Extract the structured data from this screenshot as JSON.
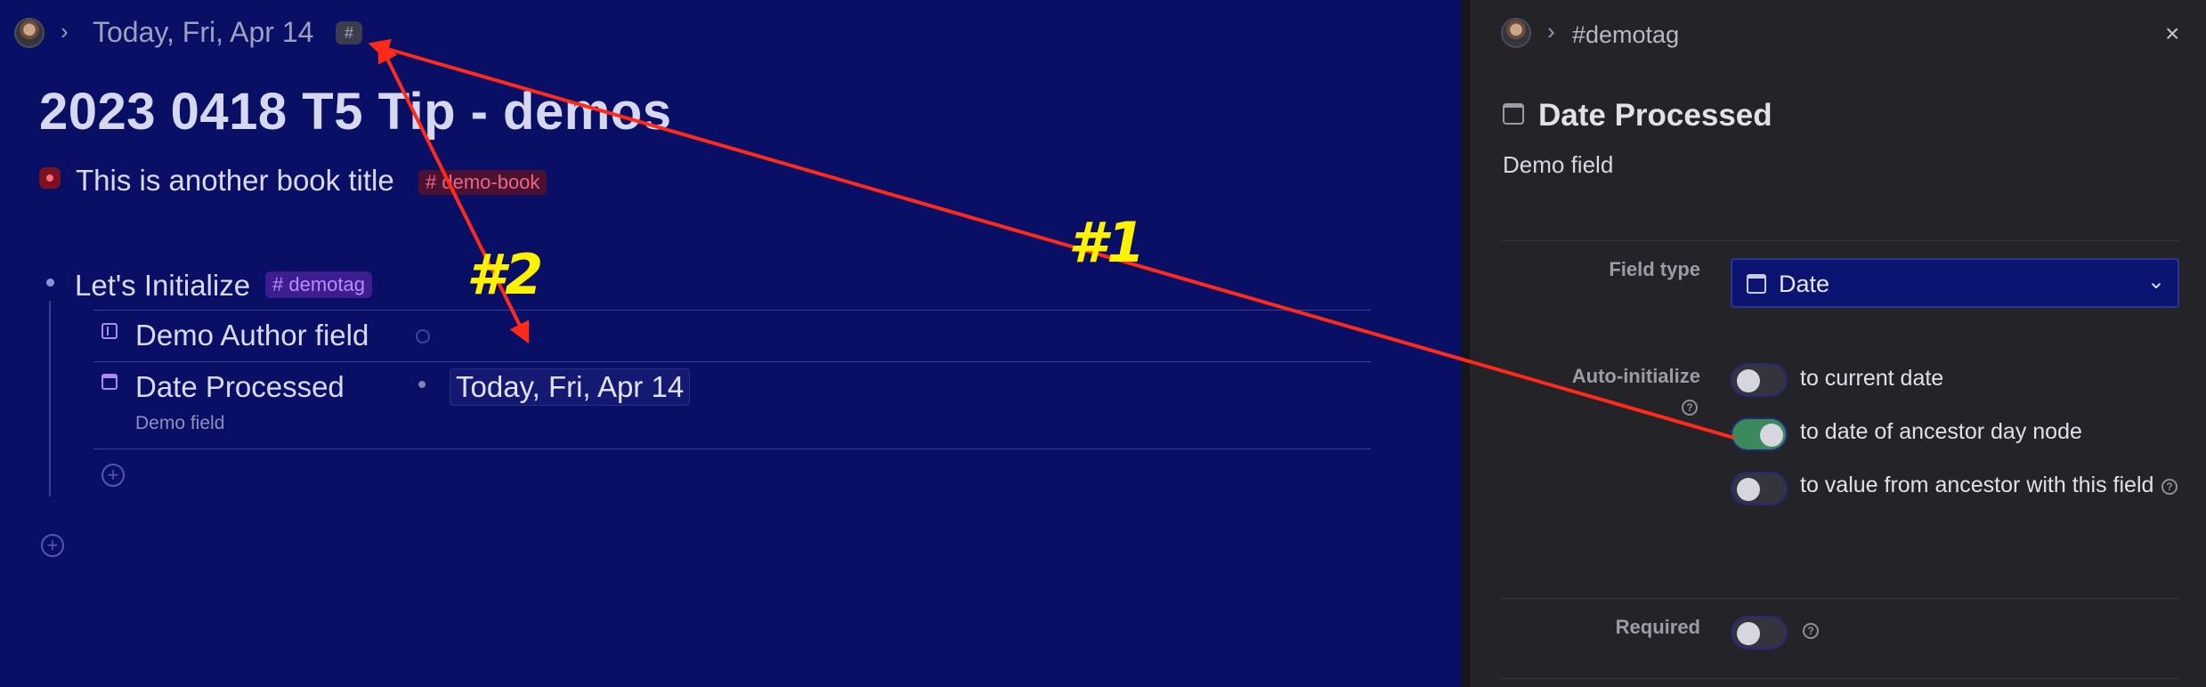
{
  "left_panel": {
    "breadcrumb": "Today, Fri, Apr 14",
    "breadcrumb_hash": "#",
    "page_title": "2023 0418 T5 Tip - demos",
    "book": {
      "title": "This is another book title",
      "tag": "# demo-book"
    },
    "node": {
      "label": "Let's Initialize",
      "tag": "# demotag"
    },
    "fields": [
      {
        "name": "Demo Author field",
        "icon": "text-field-icon"
      },
      {
        "name": "Date Processed",
        "icon": "calendar-icon",
        "value": "Today, Fri, Apr 14",
        "description": "Demo field"
      }
    ],
    "add_icon": "plus-circle-icon"
  },
  "right_panel": {
    "breadcrumb_tag": "#demotag",
    "close_icon": "close-icon",
    "title": "Date Processed",
    "description": "Demo field",
    "field_type_label": "Field type",
    "field_type_value": "Date",
    "auto_initialize_label": "Auto-initialize",
    "auto_initialize_options": [
      {
        "label": "to current date",
        "enabled": false
      },
      {
        "label": "to date of ancestor day node",
        "enabled": true
      },
      {
        "label": "to value from ancestor with this field",
        "enabled": false
      }
    ],
    "required_label": "Required",
    "required_enabled": false
  },
  "annotations": {
    "label_1": "#1",
    "label_2": "#2",
    "arrow_color": "#ff2a1a",
    "label_color": "#fff200"
  },
  "colors": {
    "left_bg": "#0a0f66",
    "right_bg": "#232328",
    "toggle_on": "#3b8a5e",
    "tag_purple": "#b88cff",
    "tag_red": "#e46a84"
  }
}
